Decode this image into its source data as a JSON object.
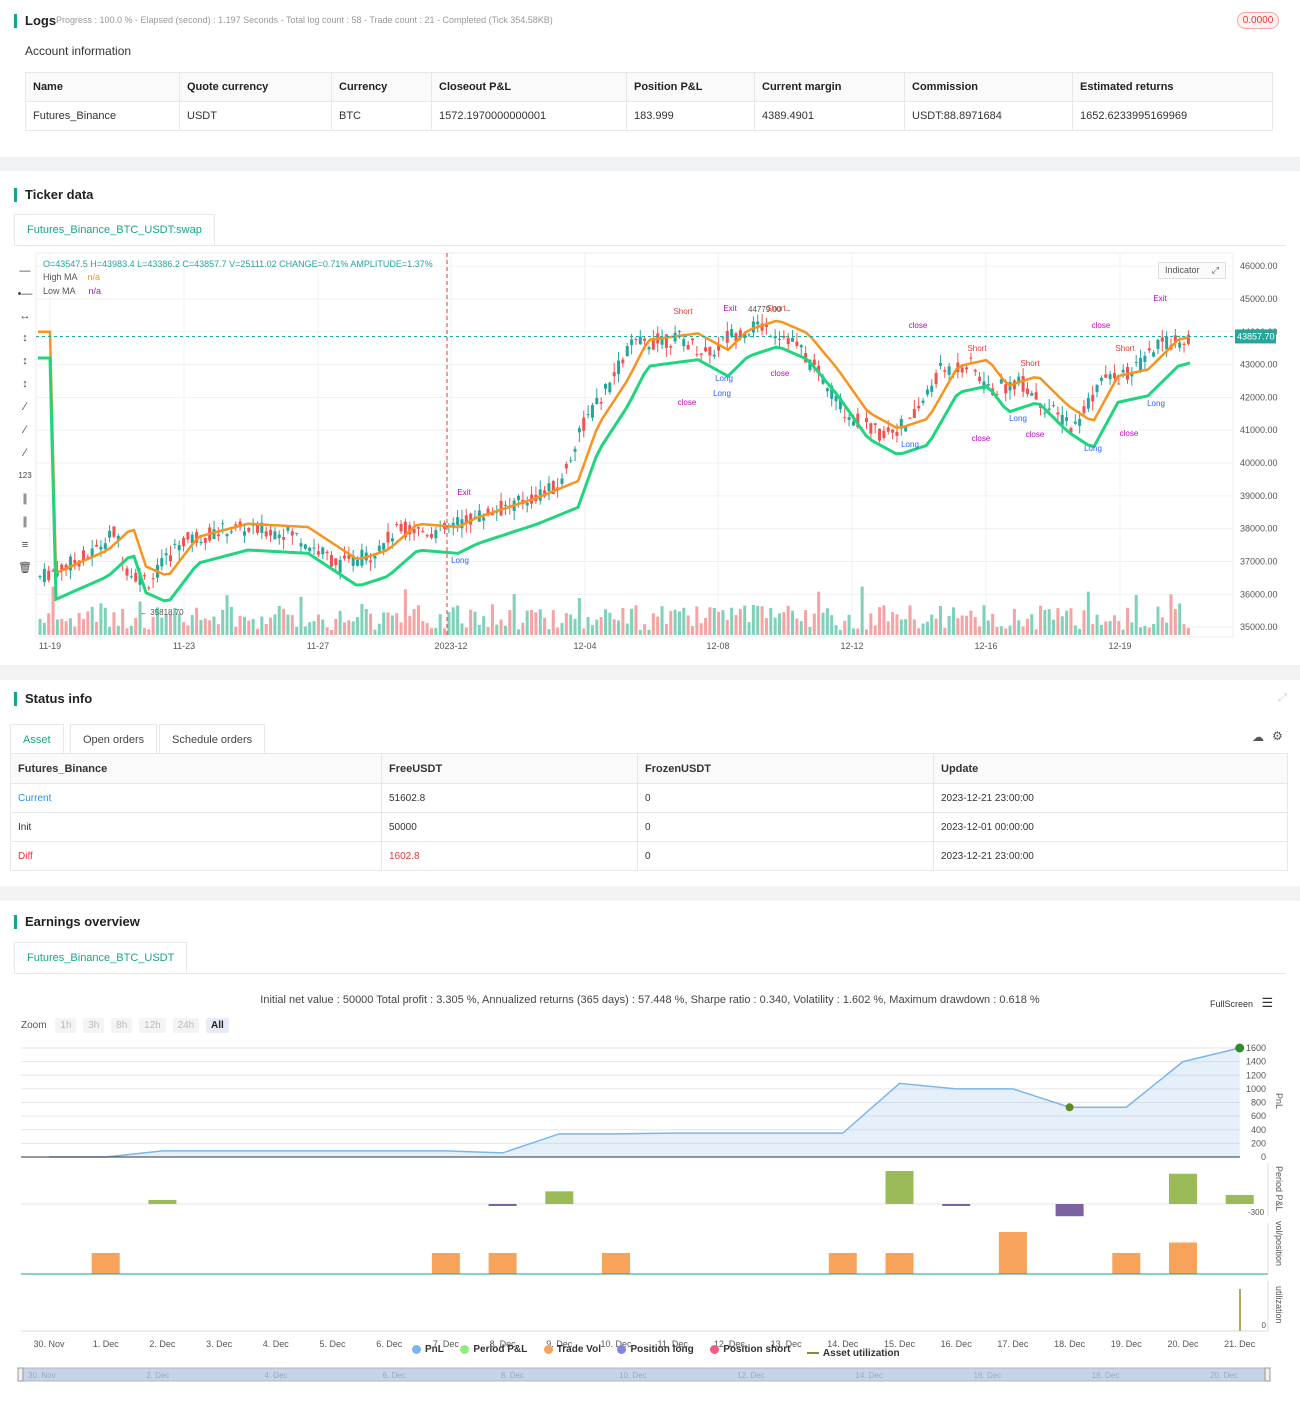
{
  "logs": {
    "title": "Logs",
    "progress_text": "Progress : 100.0 % - Elapsed (second) : 1.197  Seconds - Total log count : 58 - Trade count : 21 - Completed (Tick 354.58KB)",
    "badge": "0.0000"
  },
  "account": {
    "title": "Account information",
    "headers": [
      "Name",
      "Quote currency",
      "Currency",
      "Closeout P&L",
      "Position P&L",
      "Current margin",
      "Commission",
      "Estimated returns"
    ],
    "row": [
      "Futures_Binance",
      "USDT",
      "BTC",
      "1572.1970000000001",
      "183.999",
      "4389.4901",
      "USDT:88.8971684",
      "1652.6233995169969"
    ]
  },
  "ticker": {
    "title": "Ticker data",
    "tab": "Futures_Binance_BTC_USDT:swap",
    "ohlc": "O=43547.5 H=43983.4 L=43386.2 C=43857.7 V=25111.02 CHANGE=0.71% AMPLITUDE=1.37%",
    "high_ma_label": "High MA",
    "high_ma_value": "n/a",
    "low_ma_label": "Low MA",
    "low_ma_value": "n/a",
    "indicator_btn": "Indicator",
    "price_tag": "43857.70",
    "y_ticks": [
      "46000.00",
      "45000.00",
      "44000.00",
      "43000.00",
      "42000.00",
      "41000.00",
      "40000.00",
      "39000.00",
      "38000.00",
      "37000.00",
      "36000.00",
      "35000.00"
    ],
    "x_ticks": [
      "11-19",
      "11-23",
      "11-27",
      "2023-12",
      "12-04",
      "12-08",
      "12-12",
      "12-16",
      "12-19"
    ],
    "low_mark": "35818.70",
    "high_mark": "44779.00",
    "colors": {
      "up": "#26a69a",
      "down": "#ef5350",
      "high_ma": "#f7931e",
      "low_ma": "#1fd67e",
      "long": "#2962ff",
      "short": "#e53935",
      "close": "#c000c0"
    }
  },
  "status": {
    "title": "Status info",
    "tabs": [
      "Asset",
      "Open orders",
      "Schedule orders"
    ],
    "headers": [
      "Futures_Binance",
      "FreeUSDT",
      "FrozenUSDT",
      "Update"
    ],
    "rows": [
      [
        "Current",
        "51602.8",
        "0",
        "2023-12-21 23:00:00"
      ],
      [
        "Init",
        "50000",
        "0",
        "2023-12-01 00:00:00"
      ],
      [
        "Diff",
        "1602.8",
        "0",
        "2023-12-21 23:00:00"
      ]
    ]
  },
  "earnings": {
    "title": "Earnings overview",
    "tab": "Futures_Binance_BTC_USDT",
    "summary": "Initial net value : 50000 Total profit : 3.305 %, Annualized returns (365 days) : 57.448 %, Sharpe ratio : 0.340, Volatility : 1.602 %, Maximum drawdown : 0.618 %",
    "fullscreen": "FullScreen",
    "zoom_label": "Zoom",
    "zoom_options": [
      "1h",
      "3h",
      "8h",
      "12h",
      "24h",
      "All"
    ],
    "pnl_ticks": [
      "1600",
      "1400",
      "1200",
      "1000",
      "800",
      "600",
      "400",
      "200",
      "0"
    ],
    "pnl_axis": "PnL",
    "period_axis": "Period P&L",
    "period_tick": "-300",
    "vol_axis": "vol/position",
    "util_axis": "utilization",
    "util_tick": "0",
    "x_ticks": [
      "30. Nov",
      "1. Dec",
      "2. Dec",
      "3. Dec",
      "4. Dec",
      "5. Dec",
      "6. Dec",
      "7. Dec",
      "8. Dec",
      "9. Dec",
      "10. Dec",
      "11. Dec",
      "12. Dec",
      "13. Dec",
      "14. Dec",
      "15. Dec",
      "16. Dec",
      "17. Dec",
      "18. Dec",
      "19. Dec",
      "20. Dec",
      "21. Dec"
    ],
    "nav_ticks": [
      "30. Nov",
      "2. Dec",
      "4. Dec",
      "6. Dec",
      "8. Dec",
      "10. Dec",
      "12. Dec",
      "14. Dec",
      "16. Dec",
      "18. Dec",
      "20. Dec"
    ],
    "legend": [
      {
        "label": "PnL",
        "color": "#7cb5ec"
      },
      {
        "label": "Period P&L",
        "color": "#90ed7d"
      },
      {
        "label": "Trade Vol",
        "color": "#f7a35c"
      },
      {
        "label": "Position long",
        "color": "#8085e9"
      },
      {
        "label": "Position short",
        "color": "#f15c80"
      },
      {
        "label": "Asset utilization",
        "color": "#8d8d2a"
      }
    ]
  },
  "chart_data": {
    "type": "line",
    "title": "",
    "series": [
      {
        "name": "PnL",
        "x": [
          "30. Nov",
          "1. Dec",
          "2. Dec",
          "3. Dec",
          "4. Dec",
          "5. Dec",
          "6. Dec",
          "7. Dec",
          "8. Dec",
          "9. Dec",
          "10. Dec",
          "11. Dec",
          "12. Dec",
          "13. Dec",
          "14. Dec",
          "15. Dec",
          "16. Dec",
          "17. Dec",
          "18. Dec",
          "19. Dec",
          "20. Dec",
          "21. Dec"
        ],
        "values": [
          0,
          0,
          90,
          90,
          90,
          90,
          90,
          90,
          60,
          340,
          340,
          350,
          350,
          350,
          350,
          1080,
          1000,
          1000,
          730,
          730,
          1400,
          1600
        ]
      }
    ],
    "period_pnl": [
      0,
      0,
      90,
      0,
      0,
      0,
      0,
      0,
      -30,
      280,
      0,
      0,
      0,
      0,
      0,
      730,
      -40,
      0,
      -270,
      0,
      670,
      200
    ],
    "trade_vol": [
      0,
      1,
      0,
      0,
      0,
      0,
      0,
      1,
      1,
      0,
      1,
      0,
      0,
      0,
      1,
      1,
      0,
      2,
      0,
      1,
      1.5,
      0
    ],
    "ylim": [
      0,
      1600
    ]
  }
}
